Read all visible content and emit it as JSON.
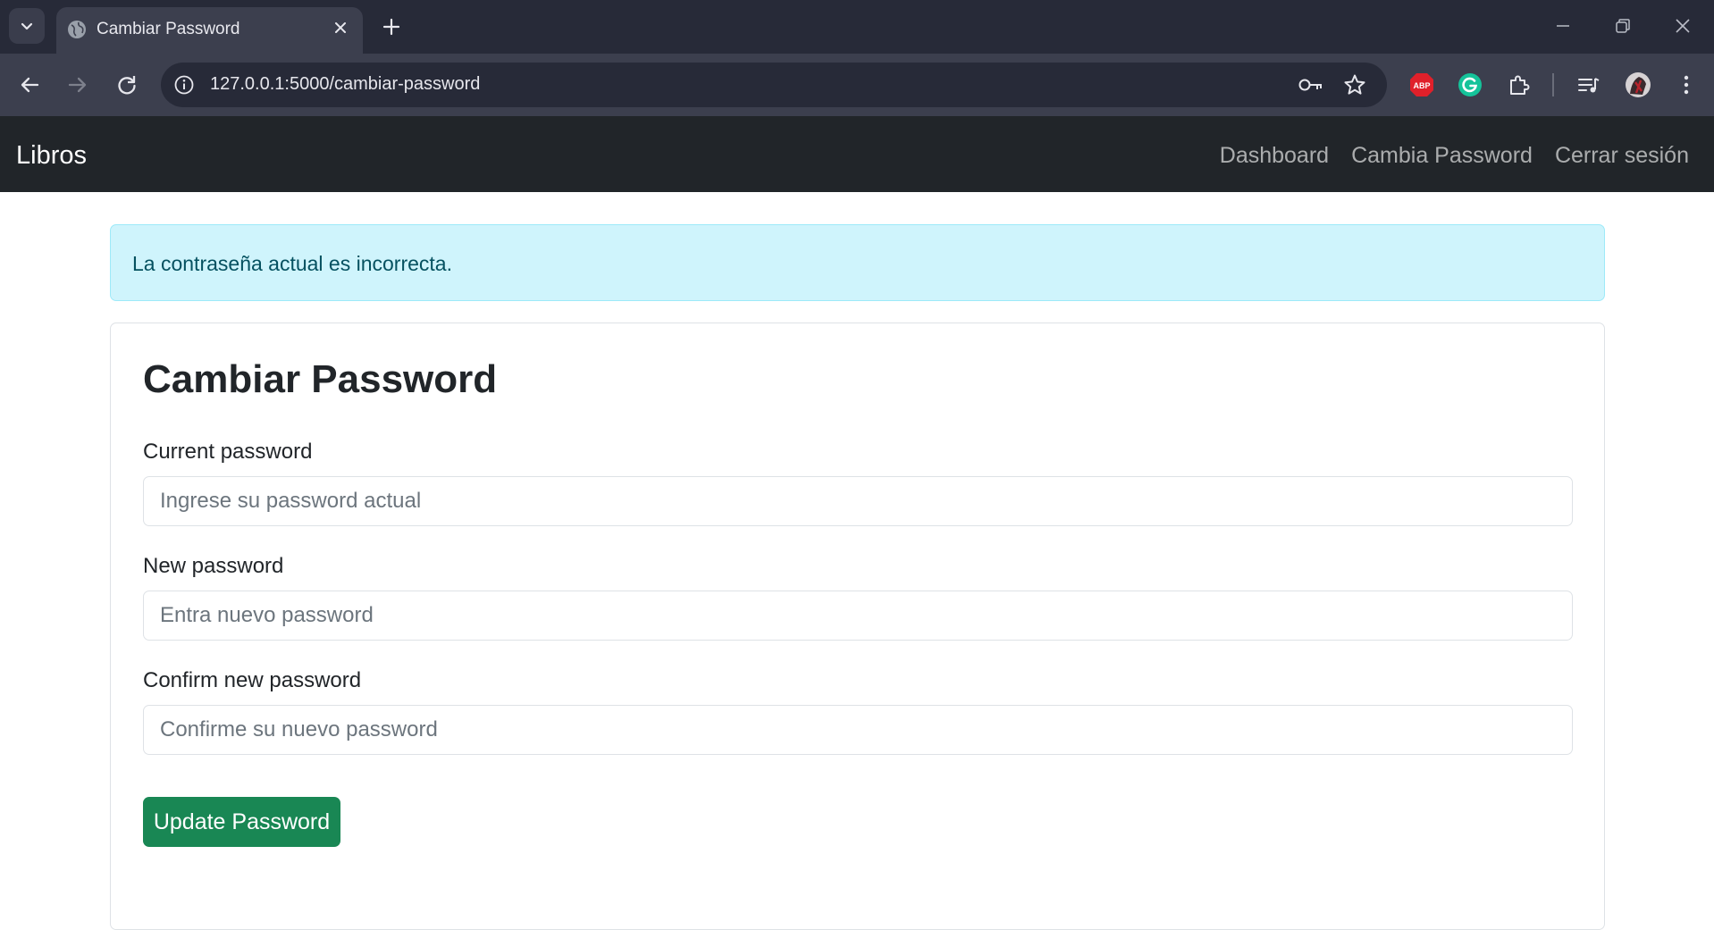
{
  "browser": {
    "tab_title": "Cambiar Password",
    "url": "127.0.0.1:5000/cambiar-password",
    "extensions": [
      "abp-icon",
      "grammarly-icon",
      "extensions-puzzle-icon",
      "media-control-icon",
      "profile-avatar"
    ],
    "abp_label": "ABP"
  },
  "navbar": {
    "brand": "Libros",
    "links": [
      "Dashboard",
      "Cambia Password",
      "Cerrar sesión"
    ]
  },
  "alert": {
    "message": "La contraseña actual es incorrecta."
  },
  "form": {
    "title": "Cambiar Password",
    "fields": [
      {
        "label": "Current password",
        "placeholder": "Ingrese su password actual",
        "value": ""
      },
      {
        "label": "New password",
        "placeholder": "Entra nuevo password",
        "value": ""
      },
      {
        "label": "Confirm new password",
        "placeholder": "Confirme su nuevo password",
        "value": ""
      }
    ],
    "submit_label": "Update Password"
  },
  "colors": {
    "navbar_bg": "#212529",
    "alert_bg": "#cff4fc",
    "alert_text": "#055160",
    "button_bg": "#198754"
  }
}
